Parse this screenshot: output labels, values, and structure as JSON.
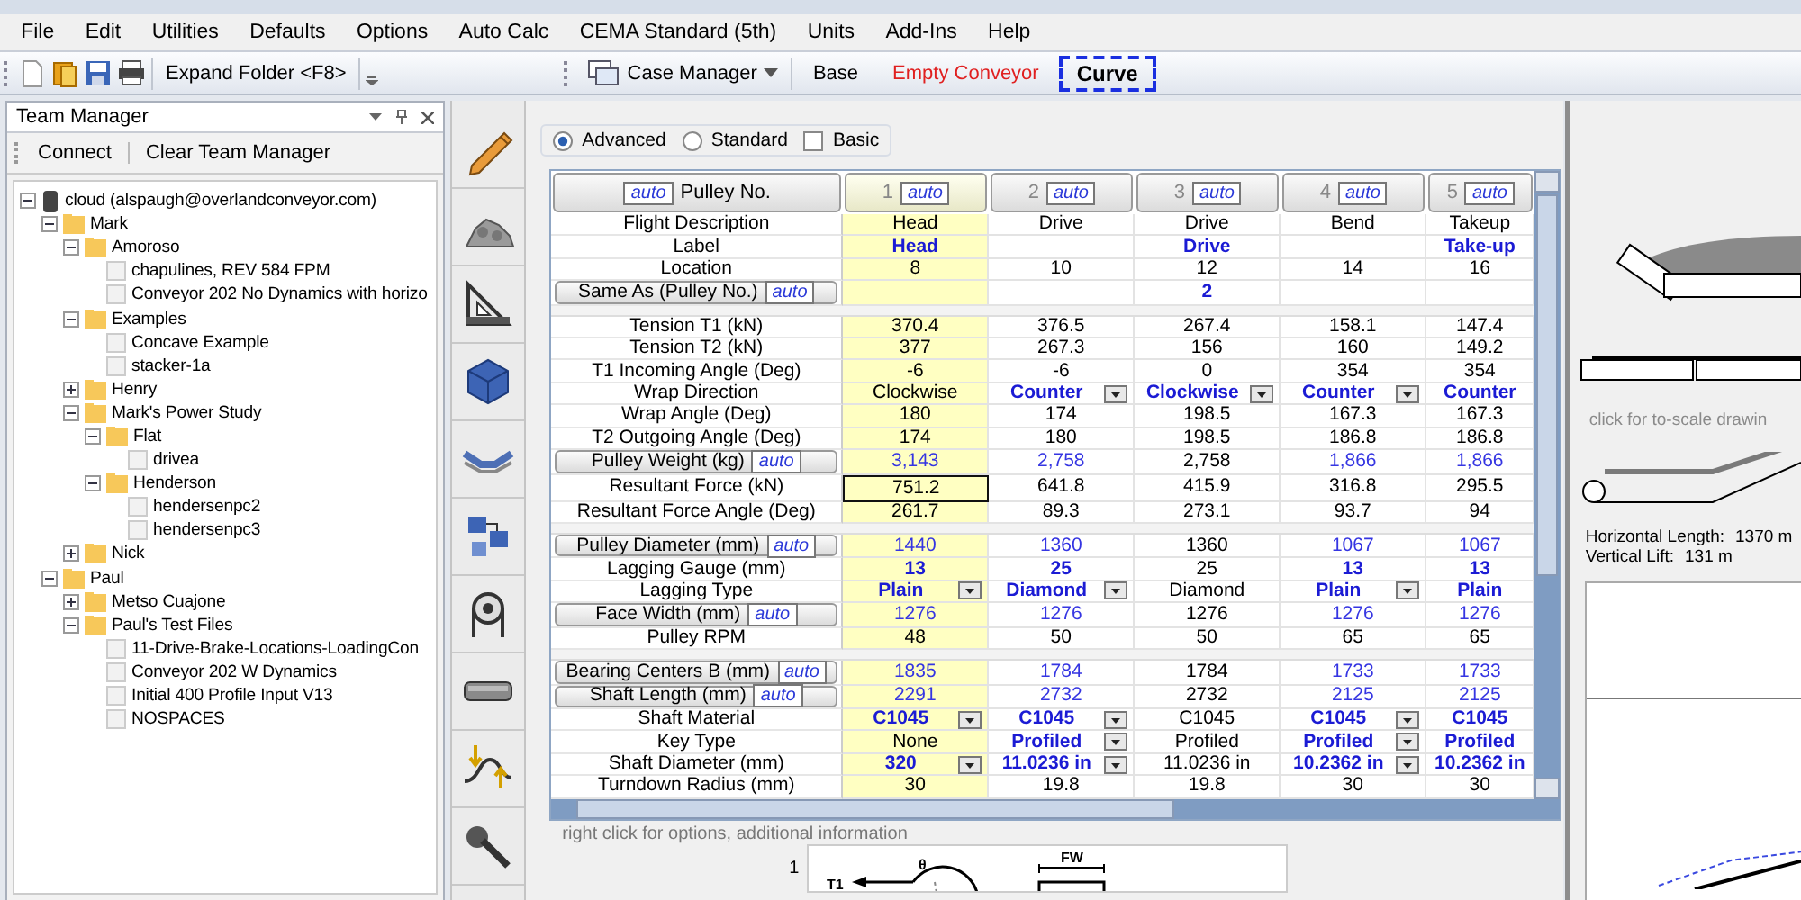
{
  "menu": [
    "File",
    "Edit",
    "Utilities",
    "Defaults",
    "Options",
    "Auto Calc",
    "CEMA Standard (5th)",
    "Units",
    "Add-Ins",
    "Help"
  ],
  "toolbar": {
    "expand_button": "Expand Folder <F8>",
    "case_manager": "Case Manager",
    "cases": [
      {
        "label": "Base",
        "selected": false,
        "color": "#000000"
      },
      {
        "label": "Empty Conveyor",
        "selected": false,
        "color": "#e02020"
      },
      {
        "label": "Curve",
        "selected": true,
        "color": "#000000"
      }
    ]
  },
  "team_manager": {
    "title": "Team Manager",
    "actions": [
      "Connect",
      "Clear Team Manager"
    ],
    "tree": [
      {
        "label": "cloud (alspaugh@overlandconveyor.com)",
        "kind": "cloud",
        "expanded": true,
        "children": [
          {
            "label": "Mark",
            "kind": "folder",
            "expanded": true,
            "children": [
              {
                "label": "Amoroso",
                "kind": "folder",
                "expanded": true,
                "children": [
                  {
                    "label": "chapulines, REV 584 FPM",
                    "kind": "file"
                  },
                  {
                    "label": "Conveyor 202 No Dynamics with horizo",
                    "kind": "file"
                  }
                ]
              },
              {
                "label": "Examples",
                "kind": "folder",
                "expanded": true,
                "children": [
                  {
                    "label": "Concave Example",
                    "kind": "file"
                  },
                  {
                    "label": "stacker-1a",
                    "kind": "file"
                  }
                ]
              },
              {
                "label": "Henry",
                "kind": "folder",
                "expanded": false
              },
              {
                "label": "Mark's Power Study",
                "kind": "folder",
                "expanded": true,
                "children": [
                  {
                    "label": "Flat",
                    "kind": "folder",
                    "expanded": true,
                    "children": [
                      {
                        "label": "drivea",
                        "kind": "file"
                      }
                    ]
                  },
                  {
                    "label": "Henderson",
                    "kind": "folder",
                    "expanded": true,
                    "children": [
                      {
                        "label": "hendersenpc2",
                        "kind": "file"
                      },
                      {
                        "label": "hendersenpc3",
                        "kind": "file"
                      }
                    ]
                  }
                ]
              },
              {
                "label": "Nick",
                "kind": "folder",
                "expanded": false
              }
            ]
          },
          {
            "label": "Paul",
            "kind": "folder",
            "expanded": true,
            "children": [
              {
                "label": "Metso Cuajone",
                "kind": "folder",
                "expanded": false
              },
              {
                "label": "Paul's Test Files",
                "kind": "folder",
                "expanded": true,
                "children": [
                  {
                    "label": "11-Drive-Brake-Locations-LoadingCon",
                    "kind": "file"
                  },
                  {
                    "label": "Conveyor 202 W Dynamics",
                    "kind": "file"
                  },
                  {
                    "label": "Initial 400 Profile Input V13",
                    "kind": "file"
                  },
                  {
                    "label": "NOSPACES",
                    "kind": "file"
                  }
                ]
              }
            ]
          }
        ]
      }
    ]
  },
  "view_modes": [
    {
      "label": "Advanced",
      "selected": true
    },
    {
      "label": "Standard",
      "selected": false
    }
  ],
  "basic_option": {
    "label": "Basic",
    "checked": false
  },
  "table": {
    "header": {
      "auto": "auto",
      "label": "Pulley No."
    },
    "columns": [
      {
        "number": "1",
        "auto": "auto",
        "selected": true
      },
      {
        "number": "2",
        "auto": "auto",
        "selected": false
      },
      {
        "number": "3",
        "auto": "auto",
        "selected": false
      },
      {
        "number": "4",
        "auto": "auto",
        "selected": false
      },
      {
        "number": "5",
        "auto": "auto",
        "selected": false
      }
    ],
    "sections": [
      [
        {
          "label": "Flight Description",
          "kind": "field",
          "cells": [
            {
              "text": "Head",
              "kind": "plain",
              "dropdown": false,
              "selected": false
            },
            {
              "text": "Drive",
              "kind": "plain",
              "dropdown": false,
              "selected": false
            },
            {
              "text": "Drive",
              "kind": "plain",
              "dropdown": false,
              "selected": false
            },
            {
              "text": "Bend",
              "kind": "plain",
              "dropdown": false,
              "selected": false
            },
            {
              "text": "Takeup",
              "kind": "plain",
              "dropdown": false,
              "selected": false
            }
          ]
        },
        {
          "label": "Label",
          "kind": "field",
          "cells": [
            {
              "text": "Head",
              "kind": "input",
              "dropdown": false,
              "selected": false
            },
            {
              "kind": "plain",
              "dropdown": false,
              "selected": false
            },
            {
              "text": "Drive",
              "kind": "input",
              "dropdown": false,
              "selected": false
            },
            {
              "kind": "plain",
              "dropdown": false,
              "selected": false
            },
            {
              "text": "Take-up",
              "kind": "input",
              "dropdown": false,
              "selected": false
            }
          ]
        },
        {
          "label": "Location",
          "kind": "field",
          "cells": [
            {
              "text": "8",
              "kind": "plain",
              "dropdown": false,
              "selected": false
            },
            {
              "text": "10",
              "kind": "plain",
              "dropdown": false,
              "selected": false
            },
            {
              "text": "12",
              "kind": "plain",
              "dropdown": false,
              "selected": false
            },
            {
              "text": "14",
              "kind": "plain",
              "dropdown": false,
              "selected": false
            },
            {
              "text": "16",
              "kind": "plain",
              "dropdown": false,
              "selected": false
            }
          ]
        },
        {
          "label": "Same As (Pulley No.)",
          "kind": "button",
          "auto": "auto",
          "cells": [
            {
              "kind": "plain",
              "dropdown": false,
              "selected": false
            },
            {
              "kind": "plain",
              "dropdown": false,
              "selected": false
            },
            {
              "text": "2",
              "kind": "input",
              "dropdown": false,
              "selected": false
            },
            {
              "kind": "plain",
              "dropdown": false,
              "selected": false
            },
            {
              "kind": "plain",
              "dropdown": false,
              "selected": false
            }
          ]
        }
      ],
      [
        {
          "label": "Tension T1 (kN)",
          "kind": "field",
          "cells": [
            {
              "text": "370.4",
              "kind": "plain",
              "dropdown": false,
              "selected": false
            },
            {
              "text": "376.5",
              "kind": "plain",
              "dropdown": false,
              "selected": false
            },
            {
              "text": "267.4",
              "kind": "plain",
              "dropdown": false,
              "selected": false
            },
            {
              "text": "158.1",
              "kind": "plain",
              "dropdown": false,
              "selected": false
            },
            {
              "text": "147.4",
              "kind": "plain",
              "dropdown": false,
              "selected": false
            }
          ]
        },
        {
          "label": "Tension T2 (kN)",
          "kind": "field",
          "cells": [
            {
              "text": "377",
              "kind": "plain",
              "dropdown": false,
              "selected": false
            },
            {
              "text": "267.3",
              "kind": "plain",
              "dropdown": false,
              "selected": false
            },
            {
              "text": "156",
              "kind": "plain",
              "dropdown": false,
              "selected": false
            },
            {
              "text": "160",
              "kind": "plain",
              "dropdown": false,
              "selected": false
            },
            {
              "text": "149.2",
              "kind": "plain",
              "dropdown": false,
              "selected": false
            }
          ]
        },
        {
          "label": "T1 Incoming Angle (Deg)",
          "kind": "field",
          "cells": [
            {
              "text": "-6",
              "kind": "plain",
              "dropdown": false,
              "selected": false
            },
            {
              "text": "-6",
              "kind": "plain",
              "dropdown": false,
              "selected": false
            },
            {
              "text": "0",
              "kind": "plain",
              "dropdown": false,
              "selected": false
            },
            {
              "text": "354",
              "kind": "plain",
              "dropdown": false,
              "selected": false
            },
            {
              "text": "354",
              "kind": "plain",
              "dropdown": false,
              "selected": false
            }
          ]
        },
        {
          "label": "Wrap Direction",
          "kind": "field",
          "cells": [
            {
              "text": "Clockwise",
              "kind": "plain",
              "dropdown": false,
              "selected": false
            },
            {
              "text": "Counter",
              "kind": "input",
              "dropdown": true,
              "selected": false
            },
            {
              "text": "Clockwise",
              "kind": "input",
              "dropdown": true,
              "selected": false
            },
            {
              "text": "Counter",
              "kind": "input",
              "dropdown": true,
              "selected": false
            },
            {
              "text": "Counter",
              "kind": "input",
              "dropdown": false,
              "selected": false
            }
          ]
        },
        {
          "label": "Wrap Angle (Deg)",
          "kind": "field",
          "cells": [
            {
              "text": "180",
              "kind": "plain",
              "dropdown": false,
              "selected": false
            },
            {
              "text": "174",
              "kind": "plain",
              "dropdown": false,
              "selected": false
            },
            {
              "text": "198.5",
              "kind": "plain",
              "dropdown": false,
              "selected": false
            },
            {
              "text": "167.3",
              "kind": "plain",
              "dropdown": false,
              "selected": false
            },
            {
              "text": "167.3",
              "kind": "plain",
              "dropdown": false,
              "selected": false
            }
          ]
        },
        {
          "label": "T2 Outgoing Angle (Deg)",
          "kind": "field",
          "cells": [
            {
              "text": "174",
              "kind": "plain",
              "dropdown": false,
              "selected": false
            },
            {
              "text": "180",
              "kind": "plain",
              "dropdown": false,
              "selected": false
            },
            {
              "text": "198.5",
              "kind": "plain",
              "dropdown": false,
              "selected": false
            },
            {
              "text": "186.8",
              "kind": "plain",
              "dropdown": false,
              "selected": false
            },
            {
              "text": "186.8",
              "kind": "plain",
              "dropdown": false,
              "selected": false
            }
          ]
        },
        {
          "label": "Pulley Weight (kg)",
          "kind": "button",
          "auto": "auto",
          "cells": [
            {
              "text": "3,143",
              "kind": "auto",
              "dropdown": false,
              "selected": false
            },
            {
              "text": "2,758",
              "kind": "auto",
              "dropdown": false,
              "selected": false
            },
            {
              "text": "2,758",
              "kind": "plain",
              "dropdown": false,
              "selected": false
            },
            {
              "text": "1,866",
              "kind": "auto",
              "dropdown": false,
              "selected": false
            },
            {
              "text": "1,866",
              "kind": "auto",
              "dropdown": false,
              "selected": false
            }
          ]
        },
        {
          "label": "Resultant Force (kN)",
          "kind": "field",
          "cells": [
            {
              "text": "751.2",
              "kind": "plain",
              "dropdown": false,
              "selected": true
            },
            {
              "text": "641.8",
              "kind": "plain",
              "dropdown": false,
              "selected": false
            },
            {
              "text": "415.9",
              "kind": "plain",
              "dropdown": false,
              "selected": false
            },
            {
              "text": "316.8",
              "kind": "plain",
              "dropdown": false,
              "selected": false
            },
            {
              "text": "295.5",
              "kind": "plain",
              "dropdown": false,
              "selected": false
            }
          ]
        },
        {
          "label": "Resultant Force Angle (Deg)",
          "kind": "field",
          "cells": [
            {
              "text": "261.7",
              "kind": "plain",
              "dropdown": false,
              "selected": false
            },
            {
              "text": "89.3",
              "kind": "plain",
              "dropdown": false,
              "selected": false
            },
            {
              "text": "273.1",
              "kind": "plain",
              "dropdown": false,
              "selected": false
            },
            {
              "text": "93.7",
              "kind": "plain",
              "dropdown": false,
              "selected": false
            },
            {
              "text": "94",
              "kind": "plain",
              "dropdown": false,
              "selected": false
            }
          ]
        }
      ],
      [
        {
          "label": "Pulley Diameter (mm)",
          "kind": "button",
          "auto": "auto",
          "cells": [
            {
              "text": "1440",
              "kind": "auto",
              "dropdown": false,
              "selected": false
            },
            {
              "text": "1360",
              "kind": "auto",
              "dropdown": false,
              "selected": false
            },
            {
              "text": "1360",
              "kind": "plain",
              "dropdown": false,
              "selected": false
            },
            {
              "text": "1067",
              "kind": "auto",
              "dropdown": false,
              "selected": false
            },
            {
              "text": "1067",
              "kind": "auto",
              "dropdown": false,
              "selected": false
            }
          ]
        },
        {
          "label": "Lagging Gauge (mm)",
          "kind": "field",
          "cells": [
            {
              "text": "13",
              "kind": "input",
              "dropdown": false,
              "selected": false
            },
            {
              "text": "25",
              "kind": "input",
              "dropdown": false,
              "selected": false
            },
            {
              "text": "25",
              "kind": "plain",
              "dropdown": false,
              "selected": false
            },
            {
              "text": "13",
              "kind": "input",
              "dropdown": false,
              "selected": false
            },
            {
              "text": "13",
              "kind": "input",
              "dropdown": false,
              "selected": false
            }
          ]
        },
        {
          "label": "Lagging Type",
          "kind": "field",
          "cells": [
            {
              "text": "Plain",
              "kind": "input",
              "dropdown": true,
              "selected": false
            },
            {
              "text": "Diamond",
              "kind": "input",
              "dropdown": true,
              "selected": false
            },
            {
              "text": "Diamond",
              "kind": "plain",
              "dropdown": false,
              "selected": false
            },
            {
              "text": "Plain",
              "kind": "input",
              "dropdown": true,
              "selected": false
            },
            {
              "text": "Plain",
              "kind": "input",
              "dropdown": false,
              "selected": false
            }
          ]
        },
        {
          "label": "Face Width (mm)",
          "kind": "button",
          "auto": "auto",
          "cells": [
            {
              "text": "1276",
              "kind": "auto",
              "dropdown": false,
              "selected": false
            },
            {
              "text": "1276",
              "kind": "auto",
              "dropdown": false,
              "selected": false
            },
            {
              "text": "1276",
              "kind": "plain",
              "dropdown": false,
              "selected": false
            },
            {
              "text": "1276",
              "kind": "auto",
              "dropdown": false,
              "selected": false
            },
            {
              "text": "1276",
              "kind": "auto",
              "dropdown": false,
              "selected": false
            }
          ]
        },
        {
          "label": "Pulley RPM",
          "kind": "field",
          "cells": [
            {
              "text": "48",
              "kind": "plain",
              "dropdown": false,
              "selected": false
            },
            {
              "text": "50",
              "kind": "plain",
              "dropdown": false,
              "selected": false
            },
            {
              "text": "50",
              "kind": "plain",
              "dropdown": false,
              "selected": false
            },
            {
              "text": "65",
              "kind": "plain",
              "dropdown": false,
              "selected": false
            },
            {
              "text": "65",
              "kind": "plain",
              "dropdown": false,
              "selected": false
            }
          ]
        }
      ],
      [
        {
          "label": "Bearing Centers B (mm)",
          "kind": "button",
          "auto": "auto",
          "cells": [
            {
              "text": "1835",
              "kind": "auto",
              "dropdown": false,
              "selected": false
            },
            {
              "text": "1784",
              "kind": "auto",
              "dropdown": false,
              "selected": false
            },
            {
              "text": "1784",
              "kind": "plain",
              "dropdown": false,
              "selected": false
            },
            {
              "text": "1733",
              "kind": "auto",
              "dropdown": false,
              "selected": false
            },
            {
              "text": "1733",
              "kind": "auto",
              "dropdown": false,
              "selected": false
            }
          ]
        },
        {
          "label": "Shaft Length (mm)",
          "kind": "button",
          "auto": "auto",
          "cells": [
            {
              "text": "2291",
              "kind": "auto",
              "dropdown": false,
              "selected": false
            },
            {
              "text": "2732",
              "kind": "auto",
              "dropdown": false,
              "selected": false
            },
            {
              "text": "2732",
              "kind": "plain",
              "dropdown": false,
              "selected": false
            },
            {
              "text": "2125",
              "kind": "auto",
              "dropdown": false,
              "selected": false
            },
            {
              "text": "2125",
              "kind": "auto",
              "dropdown": false,
              "selected": false
            }
          ]
        },
        {
          "label": "Shaft Material",
          "kind": "field",
          "cells": [
            {
              "text": "C1045",
              "kind": "input",
              "dropdown": true,
              "selected": false
            },
            {
              "text": "C1045",
              "kind": "input",
              "dropdown": true,
              "selected": false
            },
            {
              "text": "C1045",
              "kind": "plain",
              "dropdown": false,
              "selected": false
            },
            {
              "text": "C1045",
              "kind": "input",
              "dropdown": true,
              "selected": false
            },
            {
              "text": "C1045",
              "kind": "input",
              "dropdown": false,
              "selected": false
            }
          ]
        },
        {
          "label": "Key Type",
          "kind": "field",
          "cells": [
            {
              "text": "None",
              "kind": "plain",
              "dropdown": false,
              "selected": false
            },
            {
              "text": "Profiled",
              "kind": "input",
              "dropdown": true,
              "selected": false
            },
            {
              "text": "Profiled",
              "kind": "plain",
              "dropdown": false,
              "selected": false
            },
            {
              "text": "Profiled",
              "kind": "input",
              "dropdown": true,
              "selected": false
            },
            {
              "text": "Profiled",
              "kind": "input",
              "dropdown": false,
              "selected": false
            }
          ]
        },
        {
          "label": "Shaft Diameter (mm)",
          "kind": "field",
          "cells": [
            {
              "text": "320",
              "kind": "input",
              "dropdown": true,
              "selected": false
            },
            {
              "text": "11.0236 in",
              "kind": "input",
              "dropdown": true,
              "selected": false
            },
            {
              "text": "11.0236 in",
              "kind": "plain",
              "dropdown": false,
              "selected": false
            },
            {
              "text": "10.2362 in",
              "kind": "input",
              "dropdown": true,
              "selected": false
            },
            {
              "text": "10.2362 in",
              "kind": "input",
              "dropdown": false,
              "selected": false
            }
          ]
        },
        {
          "label": "Turndown Radius (mm)",
          "kind": "field",
          "cells": [
            {
              "text": "30",
              "kind": "plain",
              "dropdown": false,
              "selected": false
            },
            {
              "text": "19.8",
              "kind": "plain",
              "dropdown": false,
              "selected": false
            },
            {
              "text": "19.8",
              "kind": "plain",
              "dropdown": false,
              "selected": false
            },
            {
              "text": "30",
              "kind": "plain",
              "dropdown": false,
              "selected": false
            },
            {
              "text": "30",
              "kind": "plain",
              "dropdown": false,
              "selected": false
            }
          ]
        }
      ]
    ]
  },
  "hint": "right click for options, additional information",
  "diagram": {
    "row_label": "1",
    "tension_label": "T1",
    "angle_label": "θ",
    "width_label": "FW"
  },
  "side_panel": {
    "drawing_link": "click for to-scale drawin",
    "horizontal_length": {
      "label": "Horizontal Length:",
      "value": "1370 m"
    },
    "vertical_lift": {
      "label": "Vertical Lift:",
      "value": "131 m"
    }
  }
}
